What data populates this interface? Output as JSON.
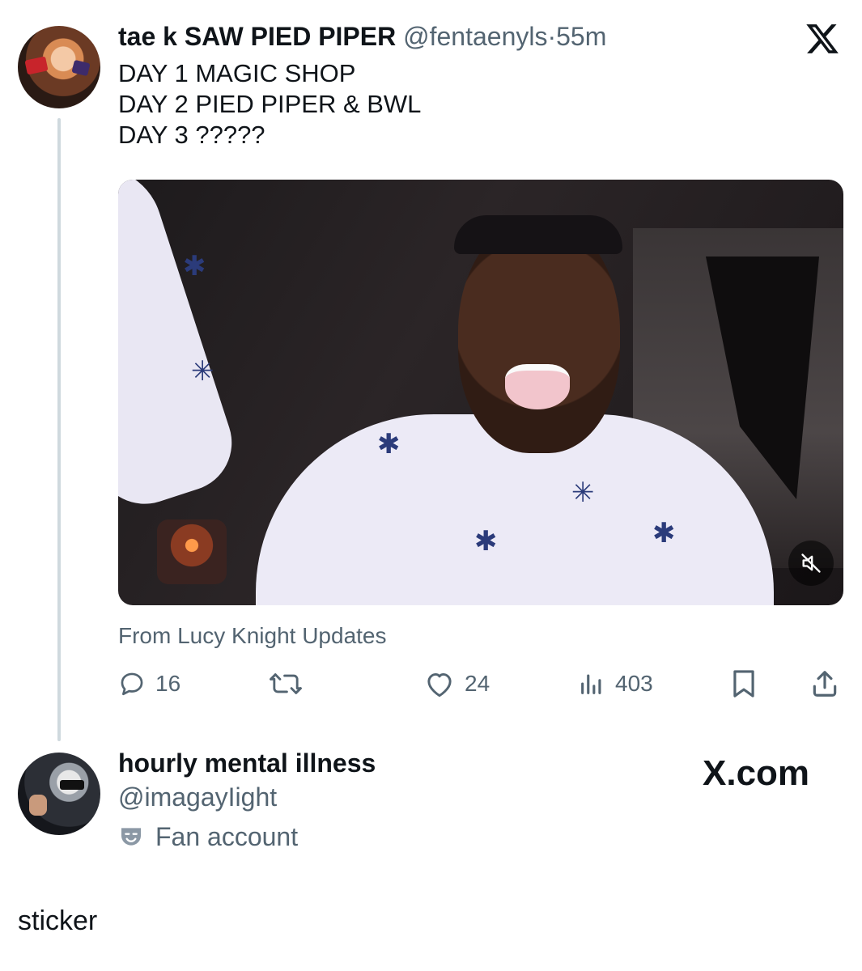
{
  "tweet": {
    "author_name": "tae k SAW PIED PIPER",
    "author_handle": "@fentaenyls",
    "separator": "·",
    "time": "55m",
    "lines": [
      "DAY 1 MAGIC SHOP",
      "DAY 2 PIED PIPER & BWL",
      "DAY 3 ?????"
    ],
    "attribution": "From Lucy Knight Updates",
    "media_icon": "muted-speaker-icon",
    "actions": {
      "replies": "16",
      "reposts": "",
      "likes": "24",
      "views": "403"
    }
  },
  "profile": {
    "name": "hourly mental illness",
    "handle": "@imagayIight",
    "badge_label": "Fan account",
    "badge_icon": "theater-mask-icon"
  },
  "watermark": {
    "site": "X.com"
  },
  "caption": "sticker",
  "colors": {
    "text_primary": "#0f1419",
    "text_secondary": "#536471",
    "thread_line": "#cfd9de"
  }
}
